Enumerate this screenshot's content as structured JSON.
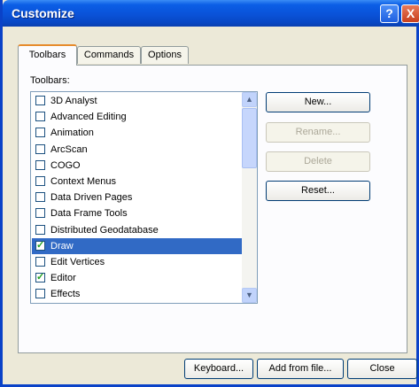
{
  "window": {
    "title": "Customize",
    "help": "?",
    "close": "X"
  },
  "tabs": [
    "Toolbars",
    "Commands",
    "Options"
  ],
  "section_label": "Toolbars:",
  "list_items": [
    {
      "label": "3D Analyst",
      "checked": false
    },
    {
      "label": "Advanced Editing",
      "checked": false
    },
    {
      "label": "Animation",
      "checked": false
    },
    {
      "label": "ArcScan",
      "checked": false
    },
    {
      "label": "COGO",
      "checked": false
    },
    {
      "label": "Context Menus",
      "checked": false
    },
    {
      "label": "Data Driven Pages",
      "checked": false
    },
    {
      "label": "Data Frame Tools",
      "checked": false
    },
    {
      "label": "Distributed Geodatabase",
      "checked": false
    },
    {
      "label": "Draw",
      "checked": true,
      "selected": true
    },
    {
      "label": "Edit Vertices",
      "checked": false
    },
    {
      "label": "Editor",
      "checked": true
    },
    {
      "label": "Effects",
      "checked": false
    }
  ],
  "side_buttons": {
    "new": "New...",
    "rename": "Rename...",
    "delete": "Delete",
    "reset": "Reset..."
  },
  "bottom_buttons": {
    "keyboard": "Keyboard...",
    "add_from_file": "Add from file...",
    "close": "Close"
  },
  "icons": {
    "scroll_up": "up-arrow-icon",
    "scroll_down": "down-arrow-icon",
    "check": "checkmark-icon"
  },
  "colors": {
    "titlebar": "#0a52d8",
    "selection": "#316ac5",
    "check": "#21a121",
    "tab_highlight": "#e68b2c"
  }
}
